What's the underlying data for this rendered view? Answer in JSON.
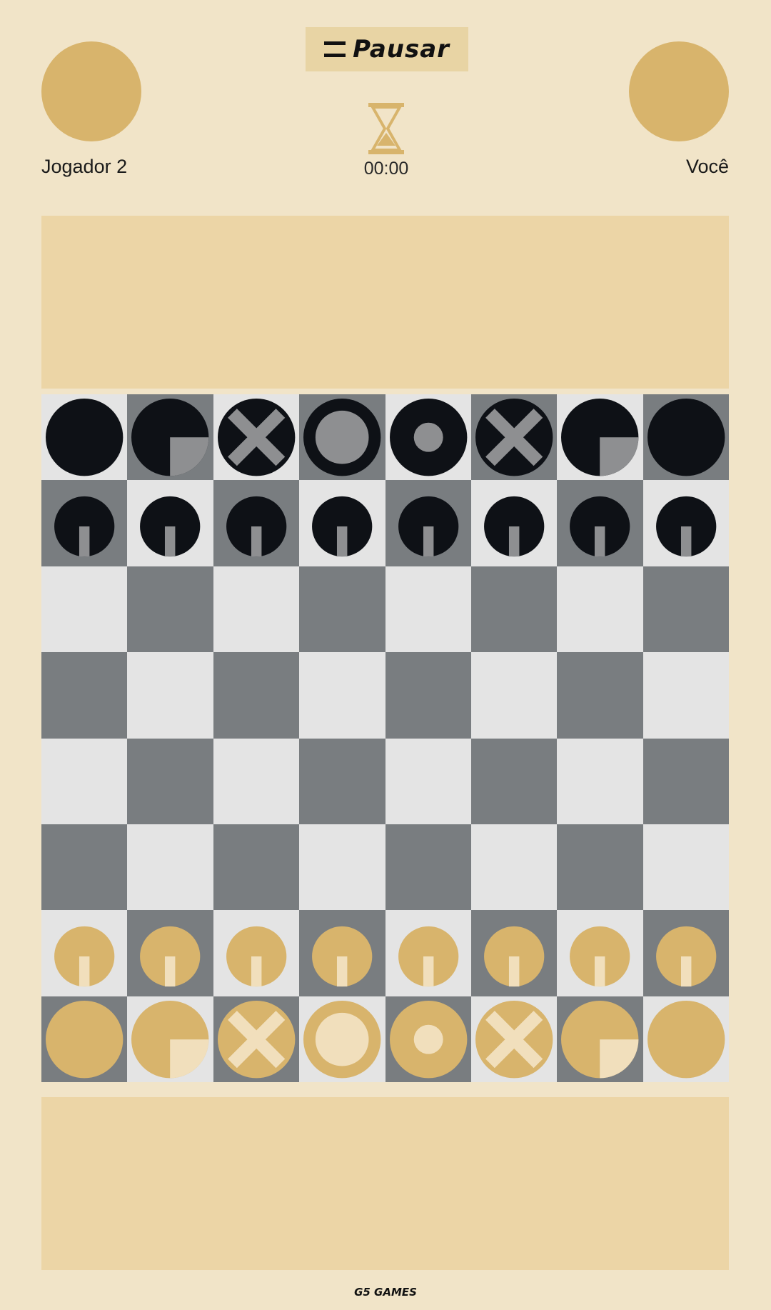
{
  "header": {
    "pause_label": "Pausar",
    "timer": "00:00"
  },
  "players": {
    "opponent": "Jogador 2",
    "you": "Você"
  },
  "footer": "G5 GAMES",
  "colors": {
    "background": "#f1e4c8",
    "tray": "#ecd5a6",
    "gold": "#d8b46c",
    "gold_light": "#f1dfbc",
    "black": "#0e1116",
    "grey": "#8e8f91",
    "light_square": "#e4e4e4",
    "dark_square": "#797d80"
  },
  "board": {
    "rows": [
      [
        "black-rook",
        "black-knight",
        "black-bishop",
        "black-queen",
        "black-king",
        "black-bishop",
        "black-knight",
        "black-rook"
      ],
      [
        "black-pawn",
        "black-pawn",
        "black-pawn",
        "black-pawn",
        "black-pawn",
        "black-pawn",
        "black-pawn",
        "black-pawn"
      ],
      [
        "",
        "",
        "",
        "",
        "",
        "",
        "",
        ""
      ],
      [
        "",
        "",
        "",
        "",
        "",
        "",
        "",
        ""
      ],
      [
        "",
        "",
        "",
        "",
        "",
        "",
        "",
        ""
      ],
      [
        "",
        "",
        "",
        "",
        "",
        "",
        "",
        ""
      ],
      [
        "gold-pawn",
        "gold-pawn",
        "gold-pawn",
        "gold-pawn",
        "gold-pawn",
        "gold-pawn",
        "gold-pawn",
        "gold-pawn"
      ],
      [
        "gold-rook",
        "gold-knight",
        "gold-bishop",
        "gold-queen",
        "gold-king",
        "gold-bishop",
        "gold-knight",
        "gold-rook"
      ]
    ]
  }
}
